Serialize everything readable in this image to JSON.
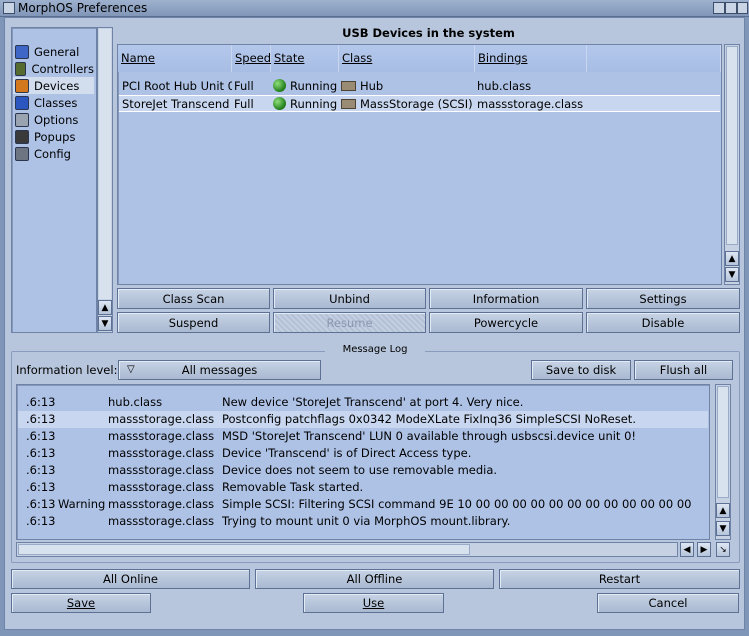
{
  "window": {
    "title": "MorphOS Preferences"
  },
  "sidebar": {
    "items": [
      {
        "label": "General",
        "icon": "question-icon",
        "color": "#3e66c6"
      },
      {
        "label": "Controllers",
        "icon": "controllers-icon",
        "color": "#556b2f"
      },
      {
        "label": "Devices",
        "icon": "devices-icon",
        "color": "#d4781e"
      },
      {
        "label": "Classes",
        "icon": "classes-icon",
        "color": "#2b56c0"
      },
      {
        "label": "Options",
        "icon": "options-icon",
        "color": "#9aa3b0"
      },
      {
        "label": "Popups",
        "icon": "popups-icon",
        "color": "#3a3a3a"
      },
      {
        "label": "Config",
        "icon": "config-icon",
        "color": "#6e7582"
      }
    ],
    "selected": "Devices"
  },
  "devices": {
    "heading": "USB Devices in the system",
    "columns": [
      "Name",
      "Speed",
      "State",
      "Class",
      "Bindings"
    ],
    "rows": [
      {
        "name": "PCI Root Hub Unit 0",
        "speed": "Full",
        "state": "Running",
        "class": "Hub",
        "bindings": "hub.class"
      },
      {
        "name": "StoreJet Transcend",
        "speed": "Full",
        "state": "Running",
        "class": "MassStorage (SCSI)",
        "bindings": "massstorage.class"
      }
    ]
  },
  "device_buttons": {
    "class_scan": "Class Scan",
    "unbind": "Unbind",
    "information": "Information",
    "settings": "Settings",
    "suspend": "Suspend",
    "resume": "Resume",
    "powercycle": "Powercycle",
    "disable": "Disable"
  },
  "log": {
    "title": "Message Log",
    "info_level_label": "Information level:",
    "info_level_value": "All messages",
    "save_to_disk": "Save to disk",
    "flush_all": "Flush all",
    "rows": [
      {
        "time": ".6:13",
        "level": "",
        "source": "hub.class",
        "message": "New device 'StoreJet Transcend' at port 4. Very nice."
      },
      {
        "time": ".6:13",
        "level": "",
        "source": "massstorage.class",
        "message": "Postconfig patchflags 0x0342 ModeXLate FixInq36 SimpleSCSI NoReset."
      },
      {
        "time": ".6:13",
        "level": "",
        "source": "massstorage.class",
        "message": "MSD 'StoreJet Transcend' LUN 0 available through usbscsi.device unit 0!"
      },
      {
        "time": ".6:13",
        "level": "",
        "source": "massstorage.class",
        "message": "Device 'Transcend' is of Direct Access type."
      },
      {
        "time": ".6:13",
        "level": "",
        "source": "massstorage.class",
        "message": "Device does not seem to use removable media."
      },
      {
        "time": ".6:13",
        "level": "",
        "source": "massstorage.class",
        "message": "Removable Task started."
      },
      {
        "time": ".6:13",
        "level": "Warning",
        "source": "massstorage.class",
        "message": "Simple SCSI: Filtering SCSI command 9E 10 00 00 00 00 00 00 00 00 00 00 00 00"
      },
      {
        "time": ".6:13",
        "level": "",
        "source": "massstorage.class",
        "message": "Trying to mount unit 0 via MorphOS mount.library."
      }
    ]
  },
  "bottom": {
    "all_online": "All Online",
    "all_offline": "All Offline",
    "restart": "Restart",
    "save": "Save",
    "use": "Use",
    "cancel": "Cancel"
  }
}
